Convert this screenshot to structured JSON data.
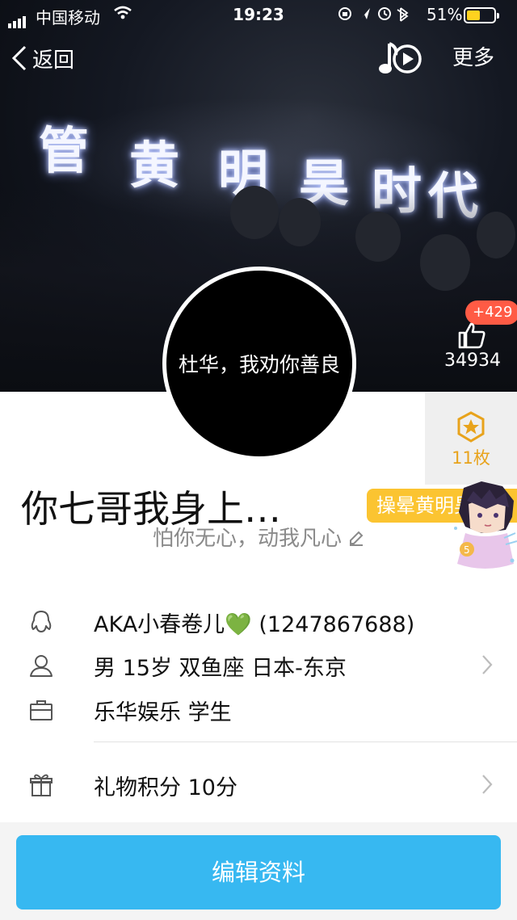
{
  "status_bar": {
    "carrier": "中国移动",
    "time": "19:23",
    "battery_percent": "51%",
    "battery_level": 0.51
  },
  "nav": {
    "back_label": "返回",
    "more_label": "更多"
  },
  "cover": {
    "neon_text": [
      "管",
      "黄",
      "明",
      "昊",
      "时",
      "代"
    ]
  },
  "profile": {
    "avatar_text": "杜华，我劝你善良",
    "like_increment": "+429",
    "like_count": "34934",
    "medal_count": "11枚",
    "name": "你七哥我身上…",
    "tag": "操晕黄明昊",
    "signature": "怕你无心，动我凡心"
  },
  "info": {
    "qq": "AKA小春卷儿💚 (1247867688)",
    "basic": "男 15岁 双鱼座 日本-东京",
    "company": "乐华娱乐 学生",
    "gift": "礼物积分 10分"
  },
  "actions": {
    "edit_profile": "编辑资料"
  },
  "colors": {
    "accent_blue": "#37b8f1",
    "badge_red": "#ff5b45",
    "medal_gold": "#e8a31c",
    "tag_yellow": "#fbc431"
  }
}
